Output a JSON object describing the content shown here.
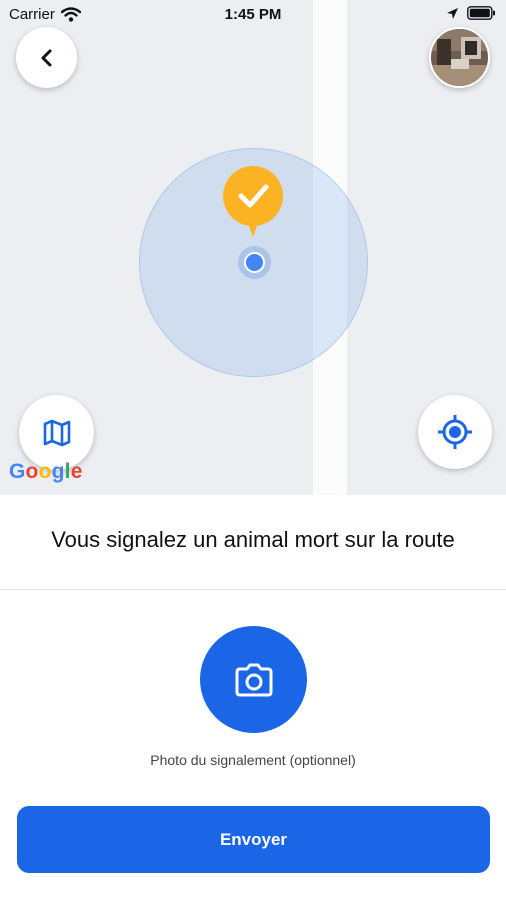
{
  "status_bar": {
    "carrier": "Carrier",
    "time": "1:45 PM"
  },
  "map": {
    "attribution": "Google",
    "icons": {
      "back": "chevron-left-icon",
      "avatar": "user-avatar",
      "map_type": "map-icon",
      "locate": "crosshair-icon",
      "pin": "check-pin-icon"
    },
    "colors": {
      "pin": "#fbb323",
      "location_dot": "#4285f4",
      "accent": "#1b66e6"
    }
  },
  "report": {
    "title": "Vous signalez un animal mort sur la route",
    "photo_caption": "Photo du signalement (optionnel)",
    "photo_icon": "camera-icon",
    "send_label": "Envoyer"
  }
}
